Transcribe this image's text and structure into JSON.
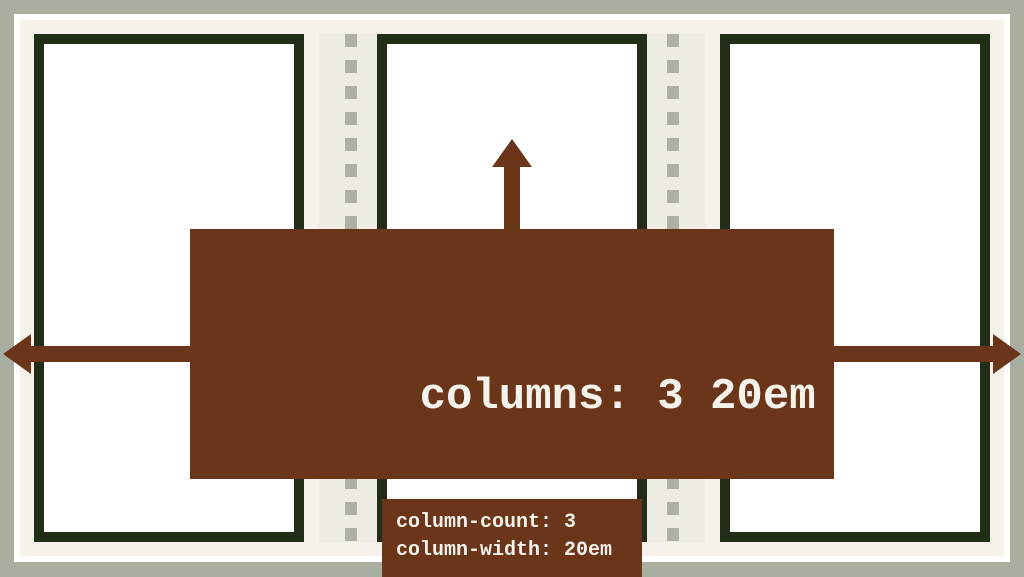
{
  "shorthand": "columns: 3 20em",
  "longhand": {
    "line1": "column-count: 3",
    "line2": "column-width: 20em"
  },
  "colors": {
    "accent": "#6a3518",
    "column_border": "#242d17",
    "page_bg": "#f4f2eb",
    "outer_bg": "#a8aea0",
    "rule": "#adb0a5"
  },
  "layout": {
    "column_count": 3
  }
}
